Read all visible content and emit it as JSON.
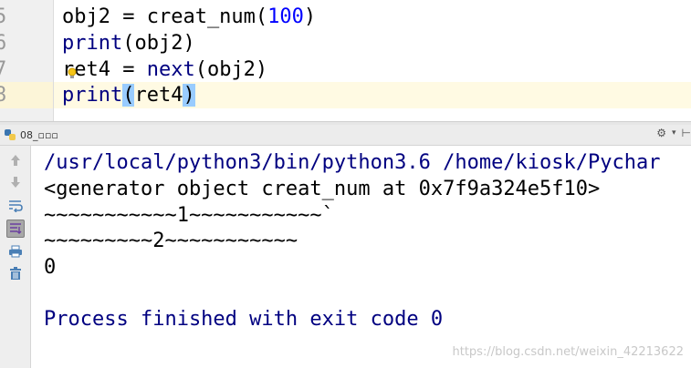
{
  "editor": {
    "line_numbers": [
      "5",
      "6",
      "7",
      "8"
    ],
    "lines": [
      {
        "plain": "obj2 = creat_num(",
        "number": "100",
        "close": ")"
      },
      {
        "keyword": "print",
        "rest": "(obj2)"
      },
      {
        "prefix": "ret4 = ",
        "keyword": "next",
        "rest": "(obj2)"
      },
      {
        "keyword": "print",
        "open": "(",
        "middle": "ret4",
        "close": ")"
      }
    ]
  },
  "run_panel": {
    "tab_label": "08_▫▫▫",
    "tools": {
      "settings": "⚙",
      "minimize": "⊢"
    }
  },
  "console": {
    "lines": [
      "/usr/local/python3/bin/python3.6 /home/kiosk/Pychar",
      "<generator object creat_num at 0x7f9a324e5f10>",
      "~~~~~~~~~~~1~~~~~~~~~~~`",
      "~~~~~~~~~2~~~~~~~~~~~",
      "0",
      "",
      "Process finished with exit code 0"
    ],
    "watermark": "https://blog.csdn.net/weixin_42213622"
  },
  "colors": {
    "keyword": "#000080",
    "number": "#0000ff",
    "current_line": "#fffae3",
    "paren_match": "#99ccff"
  }
}
